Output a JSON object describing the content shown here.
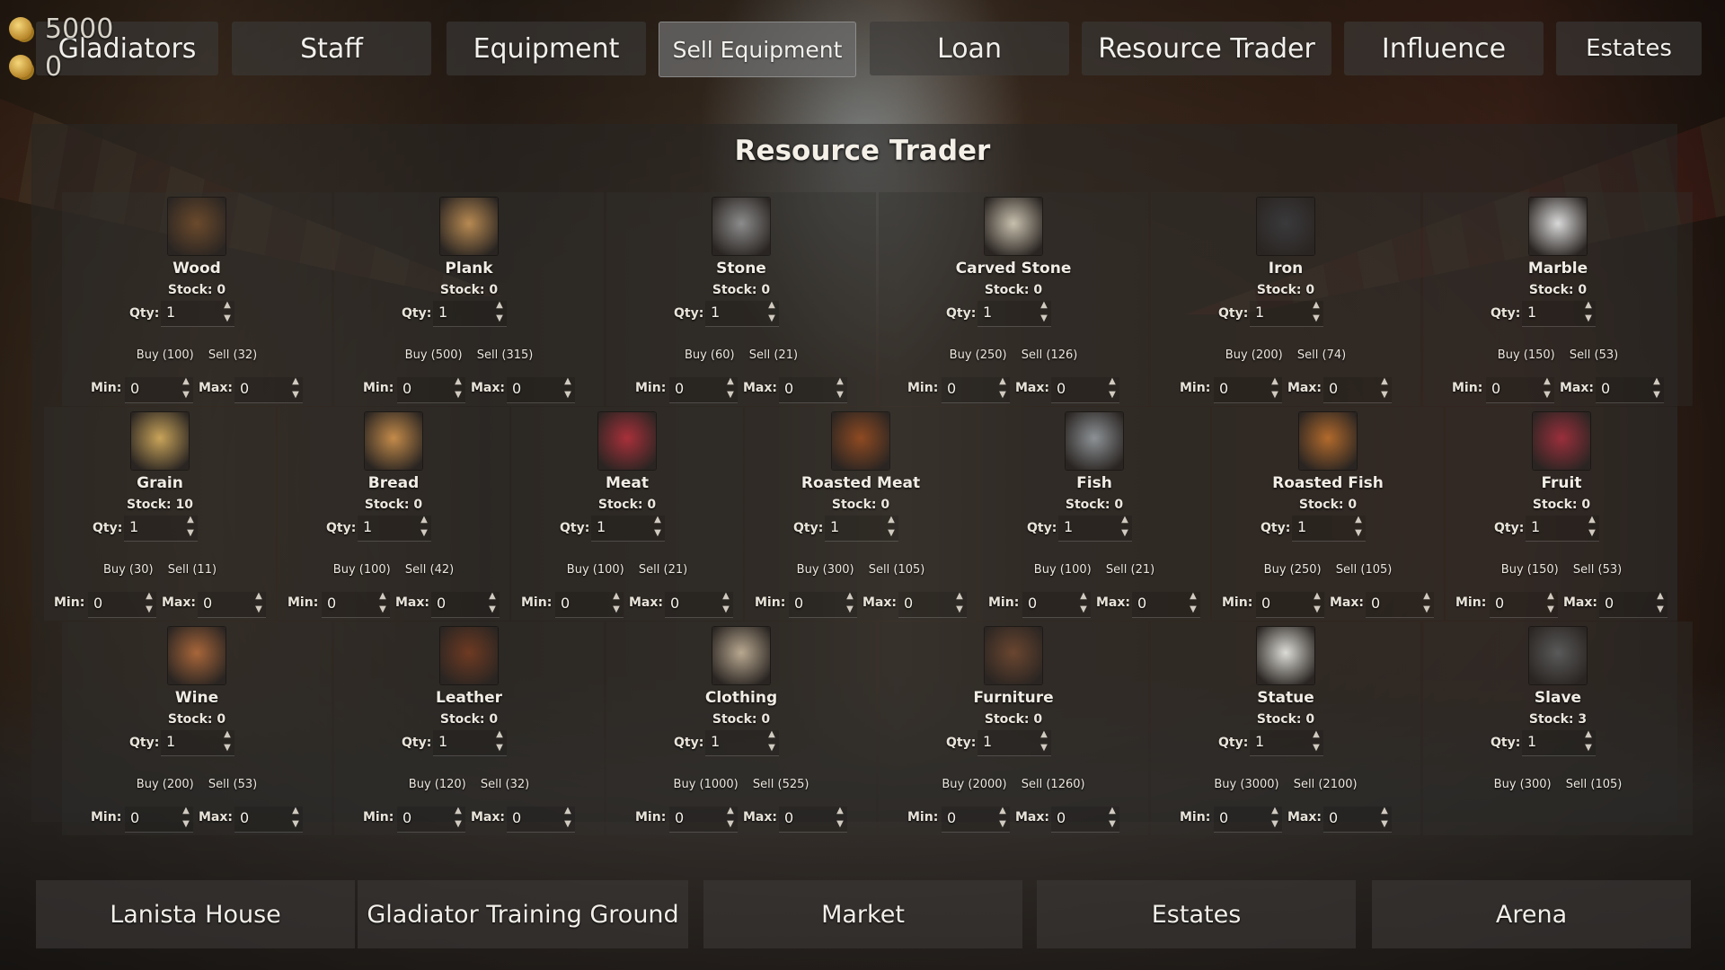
{
  "currency": [
    {
      "icon": "coin-stack-icon",
      "value": "5000"
    },
    {
      "icon": "coin-stack-icon",
      "value": "0"
    }
  ],
  "top_nav": [
    {
      "label": "Gladiators",
      "active": false
    },
    {
      "label": "Staff",
      "active": false
    },
    {
      "label": "Equipment",
      "active": false
    },
    {
      "label": "Sell Equipment",
      "active": true
    },
    {
      "label": "Loan",
      "active": false
    },
    {
      "label": "Resource Trader",
      "active": false
    },
    {
      "label": "Influence",
      "active": false
    },
    {
      "label": "Estates",
      "active": false
    }
  ],
  "panel_title": "Resource Trader",
  "labels": {
    "qty": "Qty:",
    "min": "Min:",
    "max": "Max:"
  },
  "resources": [
    {
      "name": "Wood",
      "stock": "Stock: 0",
      "qty": "1",
      "buy": "Buy (100)",
      "sell": "Sell (32)",
      "min": "0",
      "max": "0",
      "icon": "wood-icon",
      "icon_color": "#6b4a2c",
      "has_minmax": true
    },
    {
      "name": "Plank",
      "stock": "Stock: 0",
      "qty": "1",
      "buy": "Buy (500)",
      "sell": "Sell (315)",
      "min": "0",
      "max": "0",
      "icon": "plank-icon",
      "icon_color": "#b88a52",
      "has_minmax": true
    },
    {
      "name": "Stone",
      "stock": "Stock: 0",
      "qty": "1",
      "buy": "Buy (60)",
      "sell": "Sell (21)",
      "min": "0",
      "max": "0",
      "icon": "stone-icon",
      "icon_color": "#8c8c8c",
      "has_minmax": true
    },
    {
      "name": "Carved Stone",
      "stock": "Stock: 0",
      "qty": "1",
      "buy": "Buy (250)",
      "sell": "Sell (126)",
      "min": "0",
      "max": "0",
      "icon": "carved-stone-icon",
      "icon_color": "#c8c0ae",
      "has_minmax": true
    },
    {
      "name": "Iron",
      "stock": "Stock: 0",
      "qty": "1",
      "buy": "Buy (200)",
      "sell": "Sell (74)",
      "min": "0",
      "max": "0",
      "icon": "iron-icon",
      "icon_color": "#3a3a3c",
      "has_minmax": true
    },
    {
      "name": "Marble",
      "stock": "Stock: 0",
      "qty": "1",
      "buy": "Buy (150)",
      "sell": "Sell (53)",
      "min": "0",
      "max": "0",
      "icon": "marble-icon",
      "icon_color": "#d9d9d9",
      "has_minmax": true
    },
    {
      "name": "Grain",
      "stock": "Stock: 10",
      "qty": "1",
      "buy": "Buy (30)",
      "sell": "Sell (11)",
      "min": "0",
      "max": "0",
      "icon": "grain-icon",
      "icon_color": "#c9a45a",
      "has_minmax": true
    },
    {
      "name": "Bread",
      "stock": "Stock: 0",
      "qty": "1",
      "buy": "Buy (100)",
      "sell": "Sell (42)",
      "min": "0",
      "max": "0",
      "icon": "bread-icon",
      "icon_color": "#c48b4a",
      "has_minmax": true
    },
    {
      "name": "Meat",
      "stock": "Stock: 0",
      "qty": "1",
      "buy": "Buy (100)",
      "sell": "Sell (21)",
      "min": "0",
      "max": "0",
      "icon": "meat-icon",
      "icon_color": "#a8303a",
      "has_minmax": true
    },
    {
      "name": "Roasted Meat",
      "stock": "Stock: 0",
      "qty": "1",
      "buy": "Buy (300)",
      "sell": "Sell (105)",
      "min": "0",
      "max": "0",
      "icon": "roasted-meat-icon",
      "icon_color": "#8f4a22",
      "has_minmax": true
    },
    {
      "name": "Fish",
      "stock": "Stock: 0",
      "qty": "1",
      "buy": "Buy (100)",
      "sell": "Sell (21)",
      "min": "0",
      "max": "0",
      "icon": "fish-icon",
      "icon_color": "#8d9296",
      "has_minmax": true
    },
    {
      "name": "Roasted Fish",
      "stock": "Stock: 0",
      "qty": "1",
      "buy": "Buy (250)",
      "sell": "Sell (105)",
      "min": "0",
      "max": "0",
      "icon": "roasted-fish-icon",
      "icon_color": "#b26a2c",
      "has_minmax": true
    },
    {
      "name": "Fruit",
      "stock": "Stock: 0",
      "qty": "1",
      "buy": "Buy (150)",
      "sell": "Sell (53)",
      "min": "0",
      "max": "0",
      "icon": "fruit-icon",
      "icon_color": "#9a2f3c",
      "has_minmax": true
    },
    {
      "name": "Wine",
      "stock": "Stock: 0",
      "qty": "1",
      "buy": "Buy (200)",
      "sell": "Sell (53)",
      "min": "0",
      "max": "0",
      "icon": "wine-amphora-icon",
      "icon_color": "#a8663a",
      "has_minmax": true
    },
    {
      "name": "Leather",
      "stock": "Stock: 0",
      "qty": "1",
      "buy": "Buy (120)",
      "sell": "Sell (32)",
      "min": "0",
      "max": "0",
      "icon": "leather-icon",
      "icon_color": "#6e3a22",
      "has_minmax": true
    },
    {
      "name": "Clothing",
      "stock": "Stock: 0",
      "qty": "1",
      "buy": "Buy (1000)",
      "sell": "Sell (525)",
      "min": "0",
      "max": "0",
      "icon": "clothing-icon",
      "icon_color": "#b8a890",
      "has_minmax": true
    },
    {
      "name": "Furniture",
      "stock": "Stock: 0",
      "qty": "1",
      "buy": "Buy (2000)",
      "sell": "Sell (1260)",
      "min": "0",
      "max": "0",
      "icon": "furniture-icon",
      "icon_color": "#6a4630",
      "has_minmax": true
    },
    {
      "name": "Statue",
      "stock": "Stock: 0",
      "qty": "1",
      "buy": "Buy (3000)",
      "sell": "Sell (2100)",
      "min": "0",
      "max": "0",
      "icon": "statue-icon",
      "icon_color": "#dcdcd6",
      "has_minmax": true
    },
    {
      "name": "Slave",
      "stock": "Stock: 3",
      "qty": "1",
      "buy": "Buy (300)",
      "sell": "Sell (105)",
      "min": "",
      "max": "",
      "icon": "shackles-icon",
      "icon_color": "#5a5a5a",
      "has_minmax": false
    }
  ],
  "bottom_nav": [
    {
      "label": "Lanista House"
    },
    {
      "label": "Gladiator Training Ground"
    },
    {
      "label": "Market"
    },
    {
      "label": "Estates"
    },
    {
      "label": "Arena"
    }
  ]
}
